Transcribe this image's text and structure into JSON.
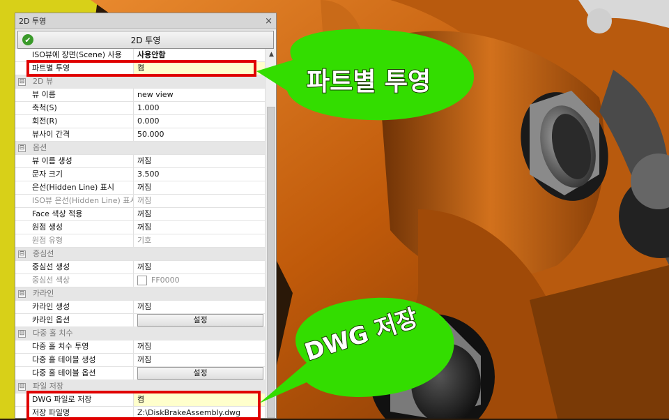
{
  "panel": {
    "title": "2D 투영",
    "close": "×",
    "project_button": "2D 투영",
    "rows": [
      {
        "type": "prop",
        "key": "ISO뷰에 장면(Scene) 사용",
        "value": "사용안함",
        "style": "bold"
      },
      {
        "type": "prop",
        "key": "파트별 투영",
        "value": "켬",
        "style": "hl"
      },
      {
        "type": "cat",
        "key": "2D 뷰",
        "toggle": "⊟"
      },
      {
        "type": "prop",
        "key": "뷰 이름",
        "value": "new view"
      },
      {
        "type": "prop",
        "key": "축척(S)",
        "value": "1.000"
      },
      {
        "type": "prop",
        "key": "회전(R)",
        "value": "0.000"
      },
      {
        "type": "prop",
        "key": "뷰사이 간격",
        "value": "50.000"
      },
      {
        "type": "cat",
        "key": "옵션",
        "toggle": "⊟"
      },
      {
        "type": "prop",
        "key": "뷰 이름 생성",
        "value": "꺼짐"
      },
      {
        "type": "prop",
        "key": "문자 크기",
        "value": "3.500"
      },
      {
        "type": "prop",
        "key": "은선(Hidden Line) 표시",
        "value": "꺼짐"
      },
      {
        "type": "prop",
        "key": "ISO뷰 은선(Hidden Line) 표시",
        "value": "꺼짐",
        "style": "dis"
      },
      {
        "type": "prop",
        "key": "Face 색상 적용",
        "value": "꺼짐"
      },
      {
        "type": "prop",
        "key": "원점 생성",
        "value": "꺼짐"
      },
      {
        "type": "prop",
        "key": "원점 유형",
        "value": "기호",
        "style": "dis"
      },
      {
        "type": "cat",
        "key": "중심선",
        "toggle": "⊟"
      },
      {
        "type": "prop",
        "key": "중심선 생성",
        "value": "꺼짐"
      },
      {
        "type": "prop",
        "key": "중심선 색상",
        "value": "FF0000",
        "style": "dis",
        "swatch": true
      },
      {
        "type": "cat",
        "key": "카라인",
        "toggle": "⊟"
      },
      {
        "type": "prop",
        "key": "카라인 생성",
        "value": "꺼짐"
      },
      {
        "type": "prop",
        "key": "카라인 옵션",
        "value": "설정",
        "style": "btn"
      },
      {
        "type": "cat",
        "key": "다중 홀 치수",
        "toggle": "⊟"
      },
      {
        "type": "prop",
        "key": "다중 홀 치수 투영",
        "value": "꺼짐"
      },
      {
        "type": "prop",
        "key": "다중 홀 테이블 생성",
        "value": "꺼짐"
      },
      {
        "type": "prop",
        "key": "다중 홀 테이블 옵션",
        "value": "설정",
        "style": "btn"
      },
      {
        "type": "cat",
        "key": "파일 저장",
        "toggle": "⊟"
      },
      {
        "type": "prop",
        "key": "DWG 파일로 저장",
        "value": "켬",
        "style": "hl"
      },
      {
        "type": "prop",
        "key": "저장 파일명",
        "value": "Z:\\DiskBrakeAssembly.dwg"
      }
    ],
    "scroll_up": "▲"
  },
  "callouts": {
    "top": "파트별 투영",
    "bottom": "DWG 저장"
  },
  "colors": {
    "callout_green": "#33dd00",
    "highlight_red": "#e00000",
    "orange_part": "#c8640a"
  }
}
